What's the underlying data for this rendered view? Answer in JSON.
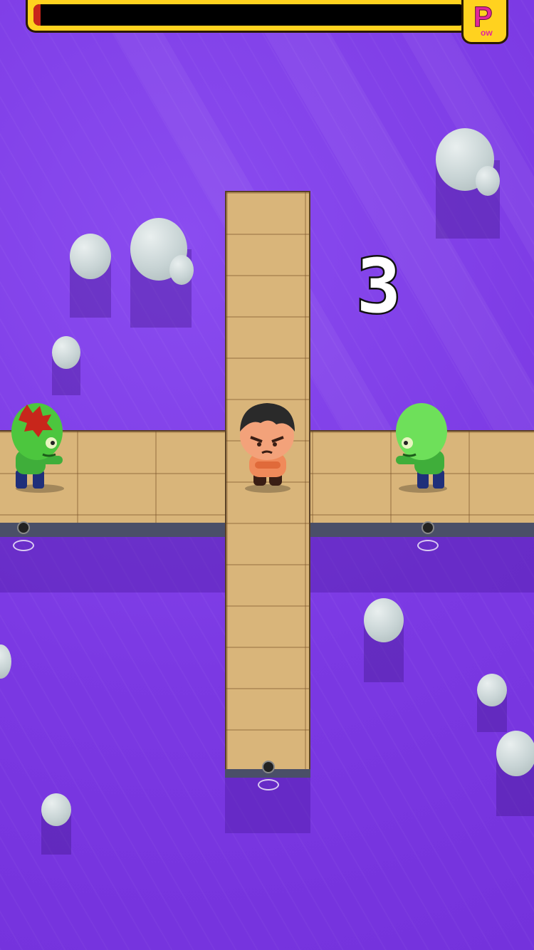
{
  "hud": {
    "power_meter_fraction": 0.015,
    "power_button_letter": "P",
    "power_button_suffix": "ow",
    "meter_color": "#c8261b",
    "frame_color": "#ffd21f"
  },
  "game": {
    "countdown": "3",
    "water_color": "#7d3ae6",
    "zombies": [
      {
        "name": "zombie-left",
        "wounded": true
      },
      {
        "name": "zombie-right",
        "wounded": false
      }
    ]
  }
}
